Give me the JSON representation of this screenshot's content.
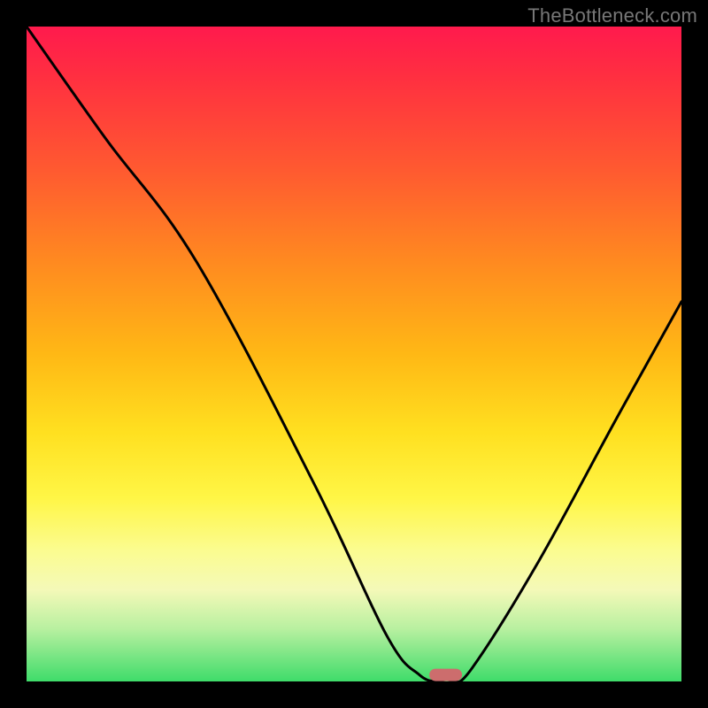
{
  "watermark": "TheBottleneck.com",
  "chart_data": {
    "type": "line",
    "title": "",
    "xlabel": "",
    "ylabel": "",
    "ylim": [
      0,
      100
    ],
    "xlim": [
      0,
      100
    ],
    "series": [
      {
        "name": "bottleneck-curve",
        "x": [
          0,
          12,
          26,
          44,
          55,
          60,
          63,
          65,
          68,
          78,
          90,
          100
        ],
        "values": [
          100,
          83,
          64,
          30,
          7,
          1,
          0,
          0,
          2,
          18,
          40,
          58
        ]
      }
    ],
    "marker": {
      "x": 64,
      "y": 0,
      "color": "#cc6d6d",
      "width": 5,
      "height": 2
    },
    "background_gradient": {
      "orientation": "vertical",
      "stops": [
        {
          "pos": 0.0,
          "color": "#ff1a4d"
        },
        {
          "pos": 0.5,
          "color": "#ffd820"
        },
        {
          "pos": 0.82,
          "color": "#fbfc90"
        },
        {
          "pos": 1.0,
          "color": "#3fdc6a"
        }
      ]
    }
  }
}
